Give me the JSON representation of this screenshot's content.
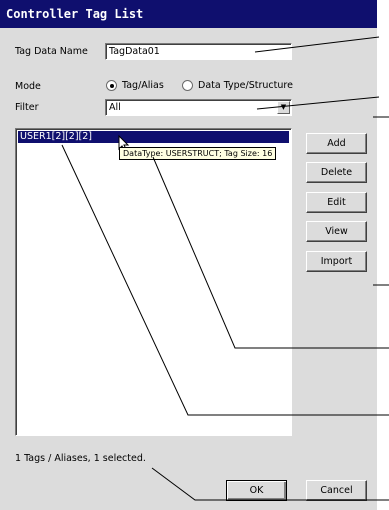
{
  "window": {
    "title": "Controller Tag List"
  },
  "tag_data_name": {
    "label": "Tag Data Name",
    "value": "TagData01"
  },
  "mode": {
    "label": "Mode",
    "options": [
      "Tag/Alias",
      "Data Type/Structure"
    ],
    "selected": "Tag/Alias"
  },
  "filter": {
    "label": "Filter",
    "value": "All"
  },
  "tag_list": {
    "items": [
      "USER1[2][2][2]"
    ],
    "tooltip": "DataType: USERSTRUCT; Tag Size: 16"
  },
  "buttons": {
    "add": "Add",
    "delete": "Delete",
    "edit": "Edit",
    "view": "View",
    "import": "Import",
    "ok": "OK",
    "cancel": "Cancel"
  },
  "status": {
    "text": "1 Tags / Aliases, 1 selected."
  },
  "icons": {
    "dropdown": "chevron-down-icon",
    "cursor": "mouse-pointer-icon"
  },
  "colors": {
    "titlebar": "#0f0f6e",
    "selection": "#0f0f6e",
    "tooltip_bg": "#ffffe1",
    "dialog_bg": "#dcdcdc"
  }
}
